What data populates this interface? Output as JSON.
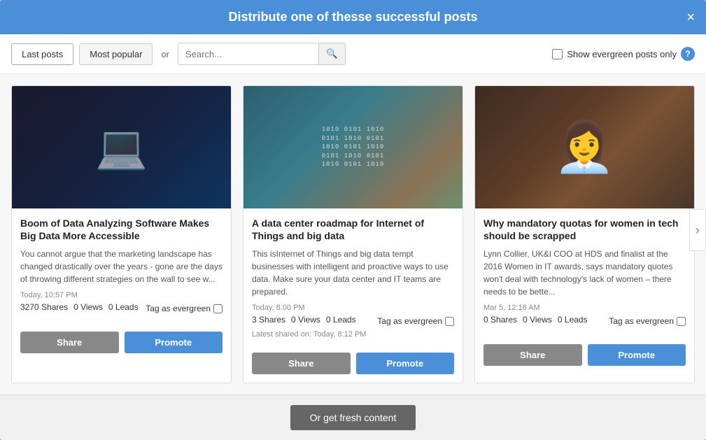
{
  "modal": {
    "title": "Distribute one of thesse successful posts",
    "close_label": "×"
  },
  "toolbar": {
    "last_posts_label": "Last posts",
    "most_popular_label": "Most popular",
    "or_label": "or",
    "search_placeholder": "Search...",
    "search_icon": "🔍",
    "evergreen_label": "Show evergreen posts only",
    "help_label": "?"
  },
  "posts": [
    {
      "title": "Boom of Data Analyzing Software Makes Big Data More Accessible",
      "excerpt": "You cannot argue that the marketing landscape has changed drastically over the years - gone are the days of throwing different strategies on the wall to see w...",
      "meta": "Today, 10:57 PM",
      "shares": "3270",
      "views": "0",
      "leads": "0",
      "tag_evergreen_label": "Tag as evergreen",
      "share_label": "Share",
      "promote_label": "Promote",
      "thumb_type": "code"
    },
    {
      "title": "A data center roadmap for Internet of Things and big data",
      "excerpt": "This isInternet of Things and big data tempt businesses with intelligent and proactive ways to use data. Make sure your data center and IT teams are prepared.",
      "meta": "Today, 8:00 PM",
      "shares": "3",
      "views": "0",
      "leads": "0",
      "latest_shared": "Latest shared on: Today, 8:12 PM",
      "tag_evergreen_label": "Tag as evergreen",
      "share_label": "Share",
      "promote_label": "Promote",
      "thumb_type": "data"
    },
    {
      "title": "Why mandatory quotas for women in tech should be scrapped",
      "excerpt": "Lynn Collier, UK&I COO at HDS and finalist at the 2016 Women in IT awards, says mandatory quotes won't deal with technology's lack of women – there needs to be bette...",
      "meta": "Mar 5, 12:16 AM",
      "shares": "0",
      "views": "0",
      "leads": "0",
      "tag_evergreen_label": "Tag as evergreen",
      "share_label": "Share",
      "promote_label": "Promote",
      "thumb_type": "woman"
    }
  ],
  "footer": {
    "fresh_content_label": "Or get fresh content"
  }
}
